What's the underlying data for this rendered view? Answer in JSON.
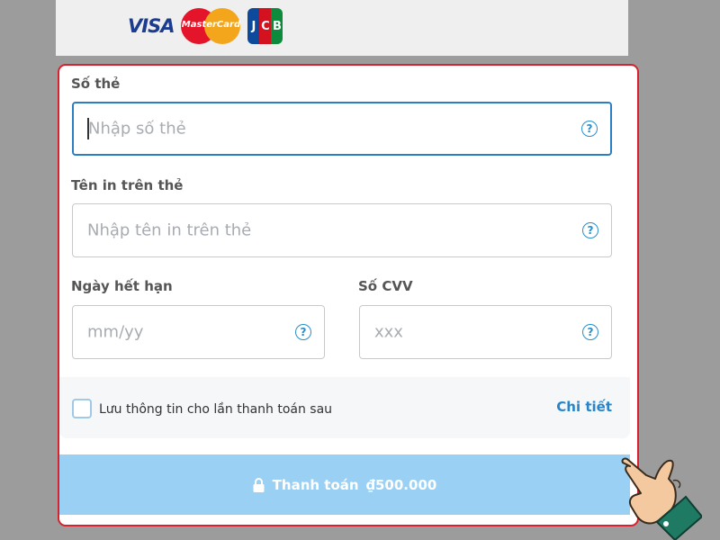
{
  "logos": {
    "visa": "VISA",
    "mastercard": "MasterCard",
    "jcb": [
      "J",
      "C",
      "B"
    ]
  },
  "form": {
    "card_number_label": "Số thẻ",
    "card_number_placeholder": "Nhập số thẻ",
    "card_name_label": "Tên in trên thẻ",
    "card_name_placeholder": "Nhập tên in trên thẻ",
    "expiry_label": "Ngày hết hạn",
    "expiry_placeholder": "mm/yy",
    "cvv_label": "Số CVV",
    "cvv_placeholder": "xxx",
    "help_glyph": "?",
    "save_info_label": "Lưu thông tin cho lần thanh toán sau",
    "details_link": "Chi tiết"
  },
  "payment": {
    "label": "Thanh toán",
    "amount": "₫500.000"
  },
  "colors": {
    "highlight_border": "#d9202d",
    "accent": "#2a85c8",
    "pay_button": "#99d0f4"
  }
}
